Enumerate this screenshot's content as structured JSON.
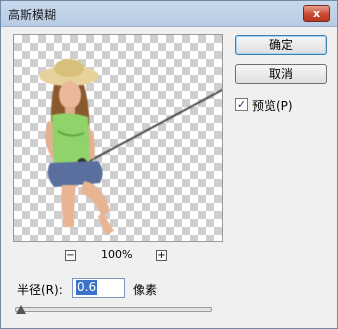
{
  "window": {
    "title": "高斯模糊",
    "close_symbol": "x"
  },
  "buttons": {
    "ok_label": "确定",
    "cancel_label": "取消"
  },
  "preview_toggle": {
    "label": "预览(P)",
    "checked": true,
    "check_symbol": "✓"
  },
  "zoom": {
    "out_symbol": "−",
    "in_symbol": "+",
    "level": "100%"
  },
  "radius": {
    "label": "半径(R):",
    "value": "0.6",
    "unit": "像素"
  },
  "slider": {
    "position_fraction": 0.0
  },
  "colors": {
    "title_bar": "#c9d9ec",
    "selection": "#3a73c8",
    "close_button": "#c84b32"
  }
}
